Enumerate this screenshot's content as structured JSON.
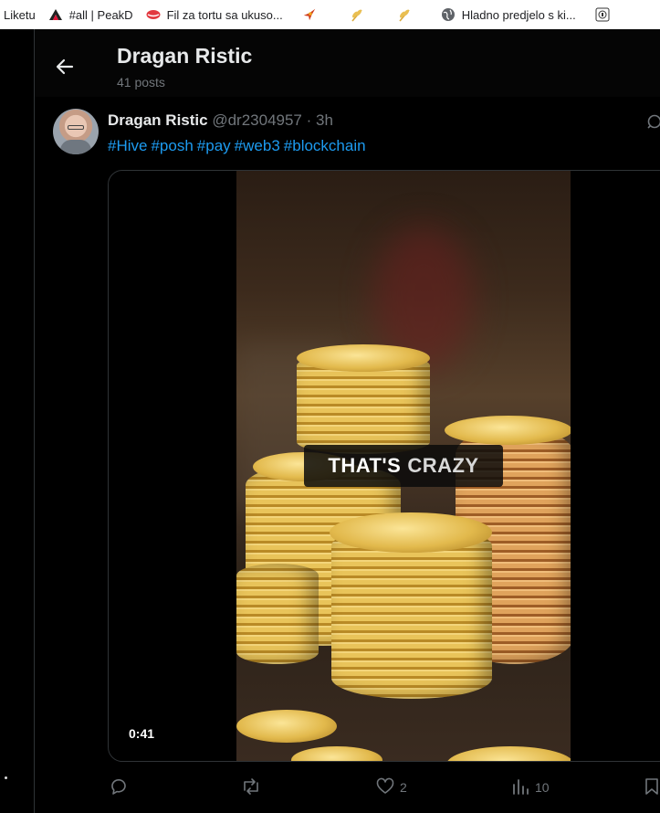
{
  "bookmarks": [
    {
      "label": "Liketu",
      "icon": "none"
    },
    {
      "label": "#all | PeakD",
      "icon": "peakd-logo-icon"
    },
    {
      "label": "Fil za tortu sa ukuso...",
      "icon": "lips-icon"
    },
    {
      "label": "",
      "icon": "bird-icon"
    },
    {
      "label": "",
      "icon": "wheat-icon"
    },
    {
      "label": "",
      "icon": "wheat-icon"
    },
    {
      "label": "Hladno predjelo s ki...",
      "icon": "globe-icon"
    },
    {
      "label": "",
      "icon": "page-icon"
    }
  ],
  "header": {
    "title": "Dragan Ristic",
    "subtitle": "41 posts"
  },
  "tweet": {
    "name": "Dragan Ristic",
    "handle": "@dr2304957",
    "separator": " · ",
    "time": "3h",
    "hashtags": [
      "#Hive",
      "#posh",
      "#pay",
      "#web3",
      "#blockchain"
    ],
    "video": {
      "caption_part1": "THAT'S",
      "caption_part2": "CRAZY",
      "duration": "0:41"
    },
    "actions": {
      "replies": "",
      "reposts": "",
      "likes": "2",
      "views": "10"
    }
  },
  "colors": {
    "background": "#000000",
    "text_primary": "#e7e9ea",
    "text_secondary": "#71767b",
    "link": "#1d9bf0",
    "border": "#2f3336"
  }
}
